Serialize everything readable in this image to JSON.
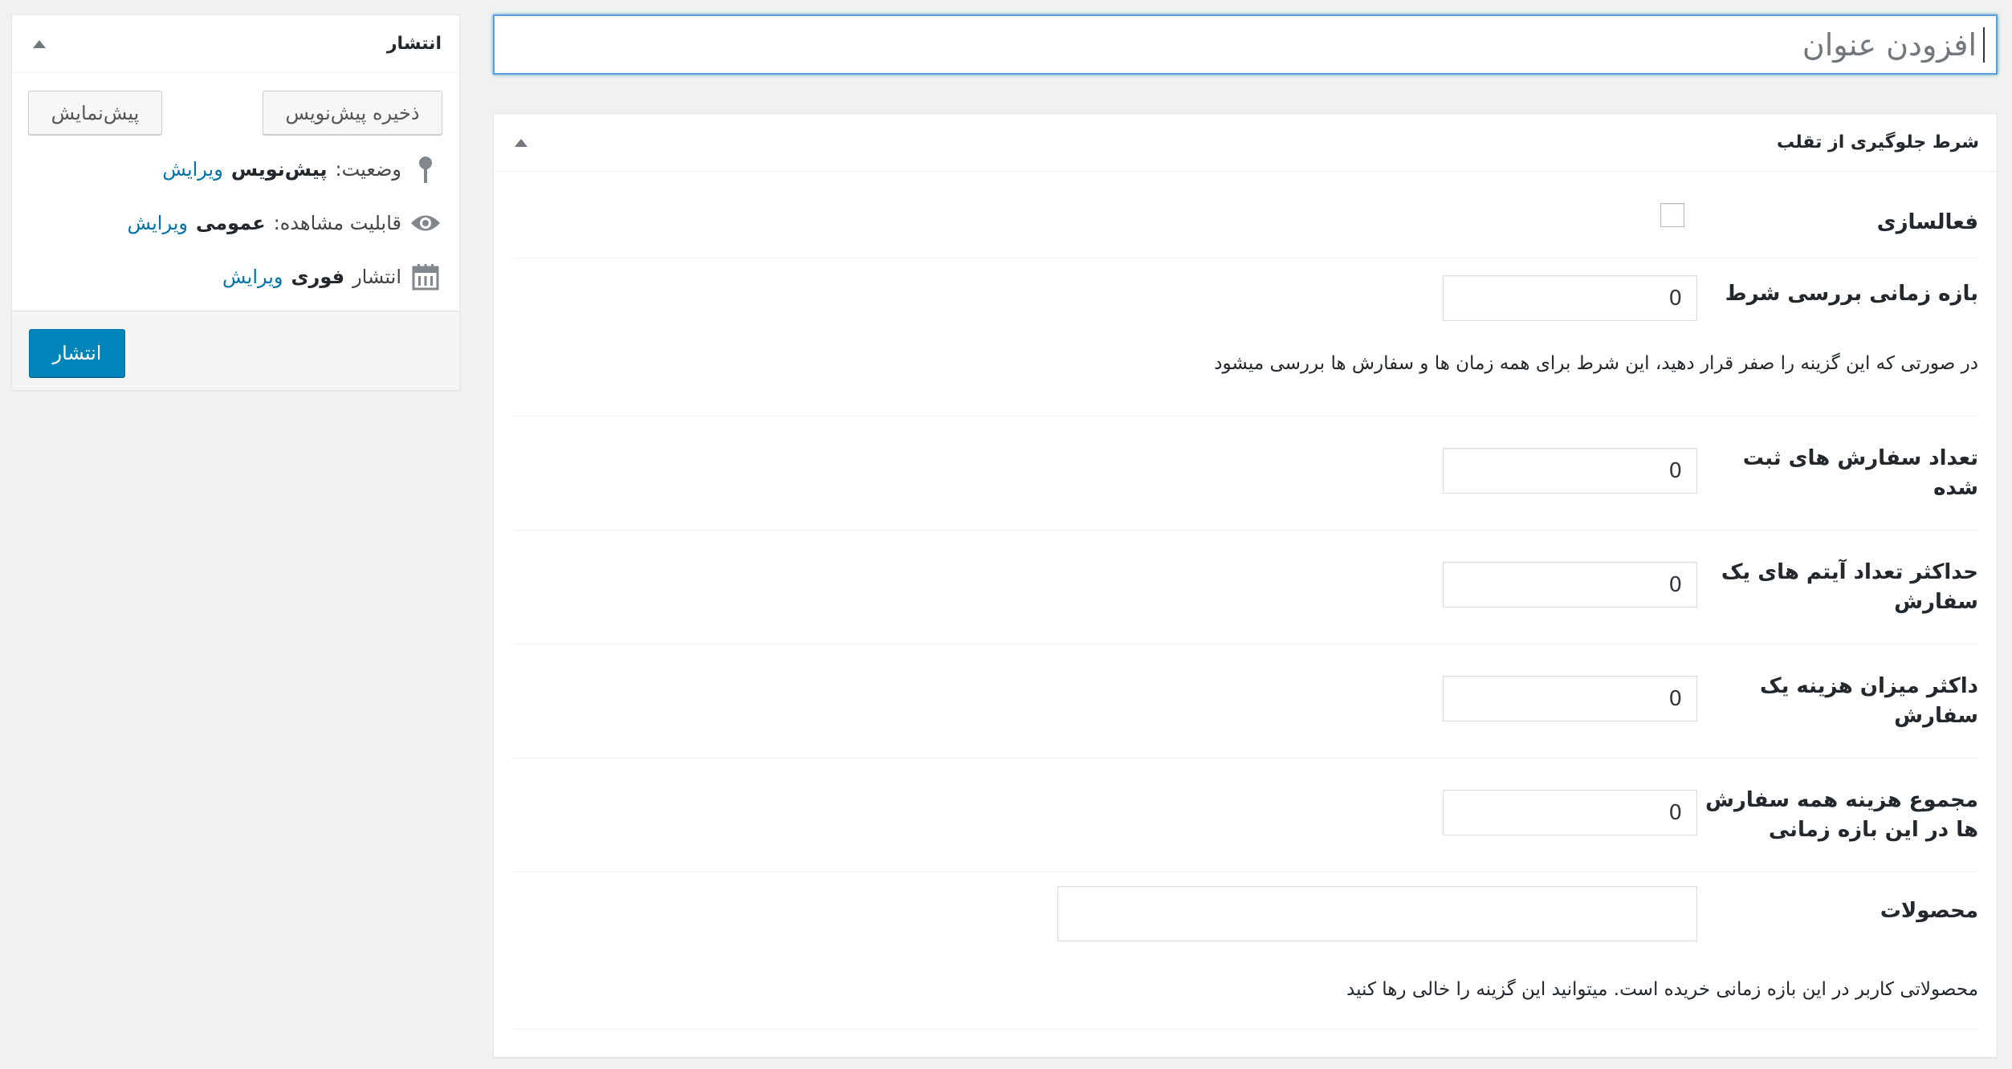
{
  "title_field": {
    "placeholder": "افزودن عنوان"
  },
  "metabox": {
    "title": "شرط جلوگیری از تقلب",
    "activation_label": "فعالسازی",
    "check_period": {
      "label": "بازه زمانی بررسی شرط",
      "value": "0"
    },
    "check_period_description": "در صورتی که این گزینه را صفر قرار دهید، این شرط برای همه زمان ها و سفارش ها بررسی میشود",
    "order_count": {
      "label": "تعداد سفارش های ثبت شده",
      "value": "0"
    },
    "max_items": {
      "label": "حداکثر تعداد آیتم های یک سفارش",
      "value": "0"
    },
    "max_cost": {
      "label": "داکثر میزان هزینه یک سفارش",
      "value": "0"
    },
    "total_cost": {
      "label": "مجموع هزینه همه سفارش ها در این بازه زمانی",
      "value": "0"
    },
    "products": {
      "label": "محصولات",
      "value": ""
    },
    "products_description": "محصولاتی کاربر در این بازه زمانی خریده است. میتوانید این گزینه را خالی رها کنید"
  },
  "publish_box": {
    "title": "انتشار",
    "save_draft_label": "ذخیره پیش‌نویس",
    "preview_label": "پیش‌نمایش",
    "status_prefix": "وضعیت:",
    "status_value": "پیش‌نویس",
    "visibility_prefix": "قابلیت مشاهده:",
    "visibility_value": "عمومی",
    "schedule_prefix": "انتشار",
    "schedule_value": "فوری",
    "edit_link": "ویرایش",
    "publish_label": "انتشار"
  },
  "colors": {
    "primary": "#0085ba",
    "link": "#0073aa",
    "focus": "#5b9dd9"
  }
}
